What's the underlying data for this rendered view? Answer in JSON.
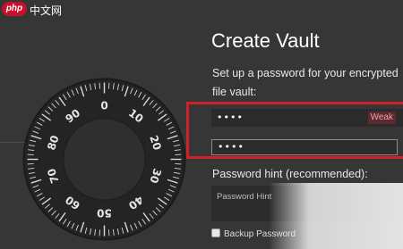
{
  "watermark": {
    "badge": "php",
    "text": "中文网"
  },
  "dial": {
    "numbers": [
      "0",
      "10",
      "20",
      "30",
      "40",
      "50",
      "60",
      "70",
      "80",
      "90"
    ]
  },
  "vault": {
    "title": "Create Vault",
    "subtitle": "Set up a password for your encrypted file vault:",
    "password": "••••",
    "strength": "Weak",
    "confirm_password": "••••",
    "hint_label": "Password hint (recommended):",
    "hint_placeholder": "Password Hint",
    "backup_label": "Backup Password"
  },
  "colors": {
    "background": "#363636",
    "highlight": "#d0202a",
    "strength_weak": "#f0a0a8"
  }
}
